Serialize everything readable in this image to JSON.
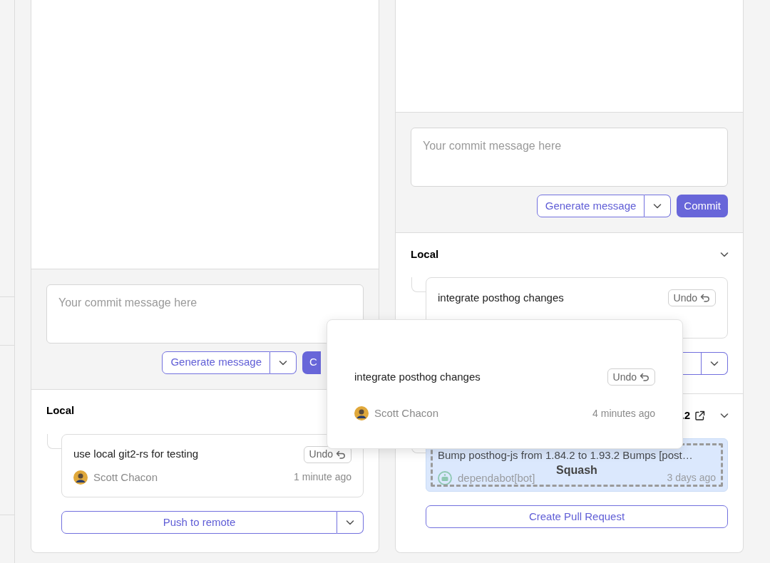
{
  "panels": [
    {
      "commit_box": {
        "placeholder": "Your commit message here"
      },
      "generate_button": "Generate message",
      "commit_button": "C",
      "commit_button_covered": true,
      "sections": [
        {
          "kind": "local",
          "title": "Local",
          "commits": [
            {
              "title": "use local git2-rs for testing",
              "undo": "Undo",
              "author": "Scott Chacon",
              "time": "1 minute ago"
            }
          ],
          "push_button": "Push to remote"
        }
      ]
    },
    {
      "commit_box": {
        "placeholder": "Your commit message here"
      },
      "generate_button": "Generate message",
      "commit_button": "Commit",
      "sections": [
        {
          "kind": "local",
          "title": "Local",
          "expanded": true,
          "commits": [
            {
              "title": "integrate posthog changes",
              "undo": "Undo"
            }
          ],
          "push_covered": true
        },
        {
          "kind": "branch",
          "branch": ".2",
          "expanded": true,
          "commits": [
            {
              "title": "Bump posthog-js from 1.84.2 to 1.93.2 Bumps [post…",
              "author": "dependabot[bot]",
              "time": "3 days ago",
              "bot": true
            }
          ],
          "drop_label": "Squash",
          "pr_button": "Create Pull Request"
        }
      ]
    }
  ],
  "drag_card": {
    "title": "integrate posthog changes",
    "undo": "Undo",
    "author": "Scott Chacon",
    "time": "4 minutes ago"
  }
}
